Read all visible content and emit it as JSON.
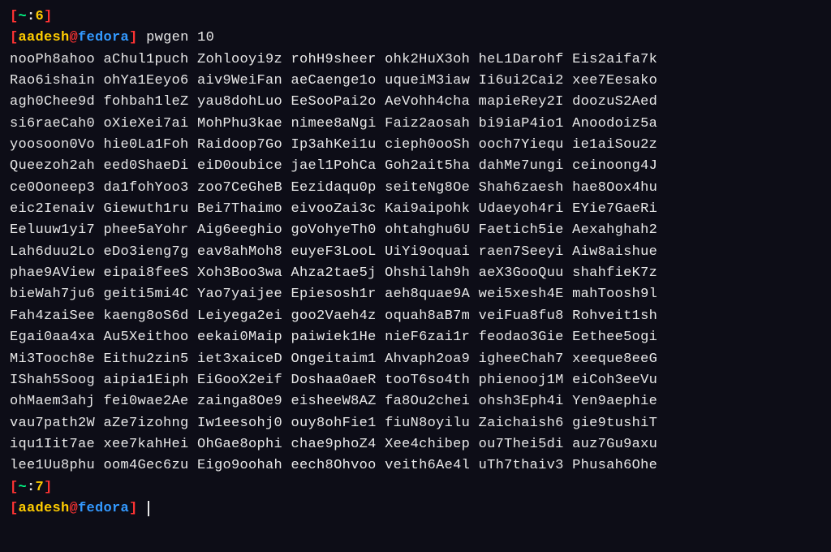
{
  "prompt1": {
    "tilde": "~",
    "num": "6"
  },
  "prompt2": {
    "user": "aadesh",
    "host": "fedora",
    "command": "pwgen 10"
  },
  "output_rows": [
    "nooPh8ahoo aChul1puch Zohlooyi9z rohH9sheer ohk2HuX3oh heL1Darohf Eis2aifa7k",
    "Rao6ishain ohYa1Eeyo6 aiv9WeiFan aeCaenge1o uqueiM3iaw Ii6ui2Cai2 xee7Eesako",
    "agh0Chee9d fohbah1leZ yau8dohLuo EeSooPai2o AeVohh4cha mapieRey2I doozuS2Aed",
    "si6raeCah0 oXieXei7ai MohPhu3kae nimee8aNgi Faiz2aosah bi9iaP4io1 Anoodoiz5a",
    "yoosoon0Vo hie0La1Foh Raidoop7Go Ip3ahKei1u cieph0ooSh ooch7Yiequ ie1aiSou2z",
    "Queezoh2ah eed0ShaeDi eiD0oubice jael1PohCa Goh2ait5ha dahMe7ungi ceinoong4J",
    "ce0Ooneep3 da1fohYoo3 zoo7CeGheB Eezidaqu0p seiteNg8Oe Shah6zaesh hae8Oox4hu",
    "eic2Ienaiv Giewuth1ru Bei7Thaimo eivooZai3c Kai9aipohk Udaeyoh4ri EYie7GaeRi",
    "Eeluuw1yi7 phee5aYohr Aig6eeghio goVohyeTh0 ohtahghu6U Faetich5ie Aexahghah2",
    "Lah6duu2Lo eDo3ieng7g eav8ahMoh8 euyeF3LooL UiYi9oquai raen7Seeyi Aiw8aishue",
    "phae9AView eipai8feeS Xoh3Boo3wa Ahza2tae5j Ohshilah9h aeX3GooQuu shahfieK7z",
    "bieWah7ju6 geiti5mi4C Yao7yaijee Epiesosh1r aeh8quae9A wei5xesh4E mahToosh9l",
    "Fah4zaiSee kaeng8oS6d Leiyega2ei goo2Vaeh4z oquah8aB7m veiFua8fu8 Rohveit1sh",
    "Egai0aa4xa Au5Xeithoo eekai0Maip paiwiek1He nieF6zai1r feodao3Gie Eethee5ogi",
    "Mi3Tooch8e Eithu2zin5 iet3xaiceD Ongeitaim1 Ahvaph2oa9 igheeChah7 xeeque8eeG",
    "IShah5Soog aipia1Eiph EiGooX2eif Doshaa0aeR tooT6so4th phienooj1M eiCoh3eeVu",
    "ohMaem3ahj fei0wae2Ae zainga8Oe9 eisheeW8AZ fa8Ou2chei ohsh3Eph4i Yen9aephie",
    "vau7path2W aZe7izohng Iw1eesohj0 ouy8ohFie1 fiuN8oyilu Zaichaish6 gie9tushiT",
    "iqu1Iit7ae xee7kahHei OhGae8ophi chae9phoZ4 Xee4chibep ou7Thei5di auz7Gu9axu",
    "lee1Uu8phu oom4Gec6zu Eigo9oohah eech8Ohvoo veith6Ae4l uTh7thaiv3 Phusah6Ohe"
  ],
  "prompt3": {
    "tilde": "~",
    "num": "7"
  },
  "prompt4": {
    "user": "aadesh",
    "host": "fedora"
  }
}
